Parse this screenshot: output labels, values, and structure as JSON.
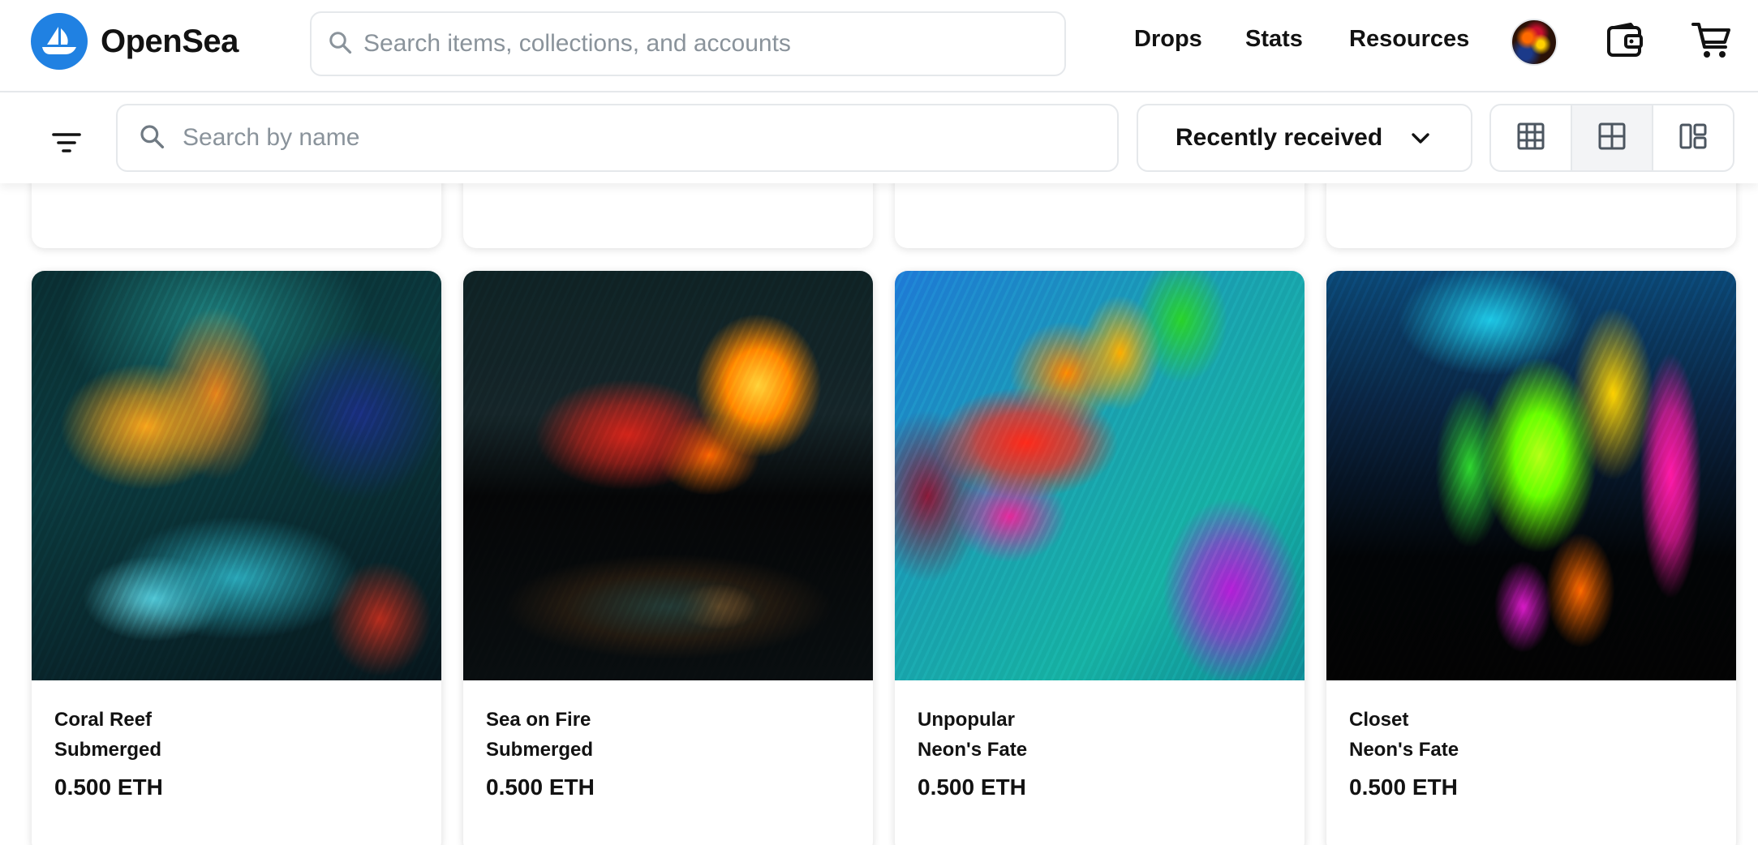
{
  "app": {
    "brand": "OpenSea",
    "brand_color": "#2081e2"
  },
  "topnav": {
    "search_placeholder": "Search items, collections, and accounts",
    "links": [
      "Drops",
      "Stats",
      "Resources"
    ],
    "icons": [
      "search-icon",
      "avatar",
      "wallet-icon",
      "cart-icon"
    ]
  },
  "toolbar": {
    "name_search_placeholder": "Search by name",
    "sort_selected": "Recently received",
    "view_modes": [
      "large-grid",
      "medium-grid",
      "compact-grid"
    ],
    "active_view": "medium-grid"
  },
  "cards": [
    {
      "name": "Coral Reef",
      "collection": "Submerged",
      "price": "0.500 ETH"
    },
    {
      "name": "Sea on Fire",
      "collection": "Submerged",
      "price": "0.500 ETH"
    },
    {
      "name": "Unpopular",
      "collection": "Neon's Fate",
      "price": "0.500 ETH"
    },
    {
      "name": "Closet",
      "collection": "Neon's Fate",
      "price": "0.500 ETH"
    }
  ]
}
